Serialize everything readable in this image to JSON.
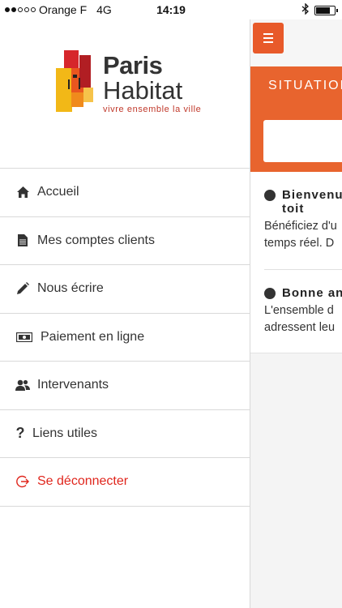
{
  "status_bar": {
    "carrier": "Orange F",
    "network": "4G",
    "time": "14:19",
    "signal_dots_filled": 2,
    "signal_dots_total": 5,
    "battery_level": 0.75
  },
  "colors": {
    "accent_orange": "#e8642e",
    "menu_button": "#e85a2a",
    "logout_red": "#e0261d"
  },
  "logo": {
    "line1": "Paris",
    "line2": "Habitat",
    "tagline": "vivre ensemble la ville"
  },
  "menu": {
    "items": [
      {
        "label": "Accueil",
        "icon": "home-icon"
      },
      {
        "label": "Mes comptes clients",
        "icon": "document-icon"
      },
      {
        "label": "Nous écrire",
        "icon": "pencil-icon"
      },
      {
        "label": "Paiement en ligne",
        "icon": "money-icon"
      },
      {
        "label": "Intervenants",
        "icon": "users-icon"
      },
      {
        "label": "Liens utiles",
        "icon": "question-icon"
      },
      {
        "label": "Se déconnecter",
        "icon": "logout-icon"
      }
    ]
  },
  "main": {
    "banner_title": "SITUATION",
    "news": [
      {
        "title_line1": "Bienvenu",
        "title_line2": "toit",
        "body_line1": "Bénéficiez d'u",
        "body_line2": "temps réel. D"
      },
      {
        "title_line1": "Bonne an",
        "body_line1": "L'ensemble d",
        "body_line2": "adressent leu"
      }
    ]
  }
}
